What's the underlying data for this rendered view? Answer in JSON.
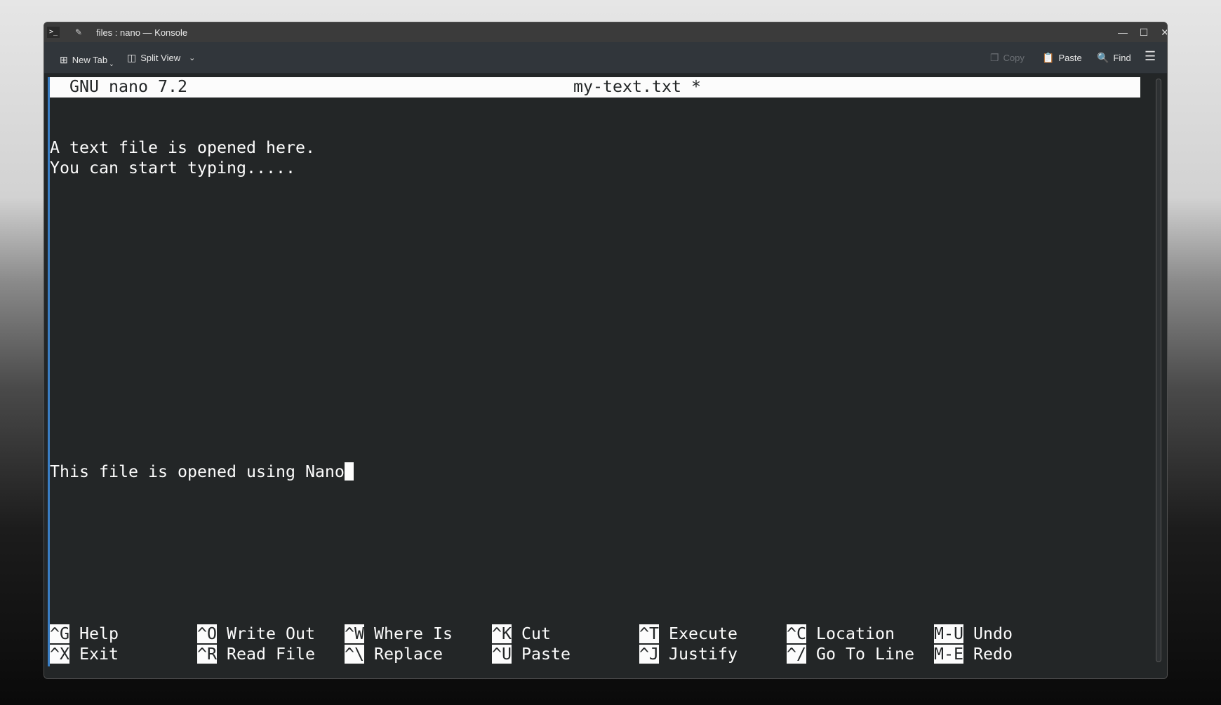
{
  "window": {
    "title": "files : nano — Konsole"
  },
  "toolbar": {
    "new_tab": "New Tab",
    "split_view": "Split View",
    "copy": "Copy",
    "paste": "Paste",
    "find": "Find"
  },
  "nano": {
    "version": "GNU nano 7.2",
    "filename": "my-text.txt *",
    "lines": [
      "A text file is opened here.",
      "You can start typing.....",
      "This file is opened using Nano"
    ],
    "shortcuts_row1": [
      {
        "key": "^G",
        "label": "Help"
      },
      {
        "key": "^O",
        "label": "Write Out"
      },
      {
        "key": "^W",
        "label": "Where Is"
      },
      {
        "key": "^K",
        "label": "Cut"
      },
      {
        "key": "^T",
        "label": "Execute"
      },
      {
        "key": "^C",
        "label": "Location"
      },
      {
        "key": "M-U",
        "label": "Undo"
      }
    ],
    "shortcuts_row2": [
      {
        "key": "^X",
        "label": "Exit"
      },
      {
        "key": "^R",
        "label": "Read File"
      },
      {
        "key": "^\\",
        "label": "Replace"
      },
      {
        "key": "^U",
        "label": "Paste"
      },
      {
        "key": "^J",
        "label": "Justify"
      },
      {
        "key": "^/",
        "label": "Go To Line"
      },
      {
        "key": "M-E",
        "label": "Redo"
      }
    ]
  }
}
